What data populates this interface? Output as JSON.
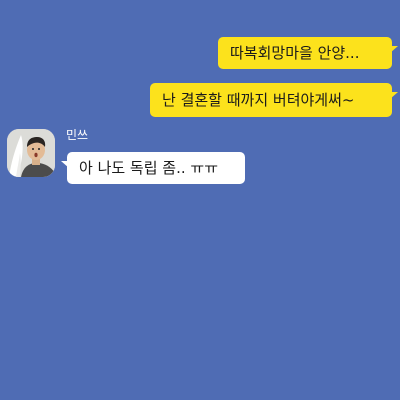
{
  "chat": {
    "background_color": "#4f6cb4",
    "my_bubble_color": "#fce21c",
    "other_bubble_color": "#ffffff",
    "messages": [
      {
        "sender": "me",
        "text": "따복회망마을 안양..."
      },
      {
        "sender": "me",
        "text": "난 결혼할 때까지 버텨야게써~"
      },
      {
        "sender": "other",
        "sender_name": "민쓰",
        "text": "아 나도 독립 좀.. ㅠㅠ"
      }
    ],
    "other_avatar": "profile-photo"
  }
}
